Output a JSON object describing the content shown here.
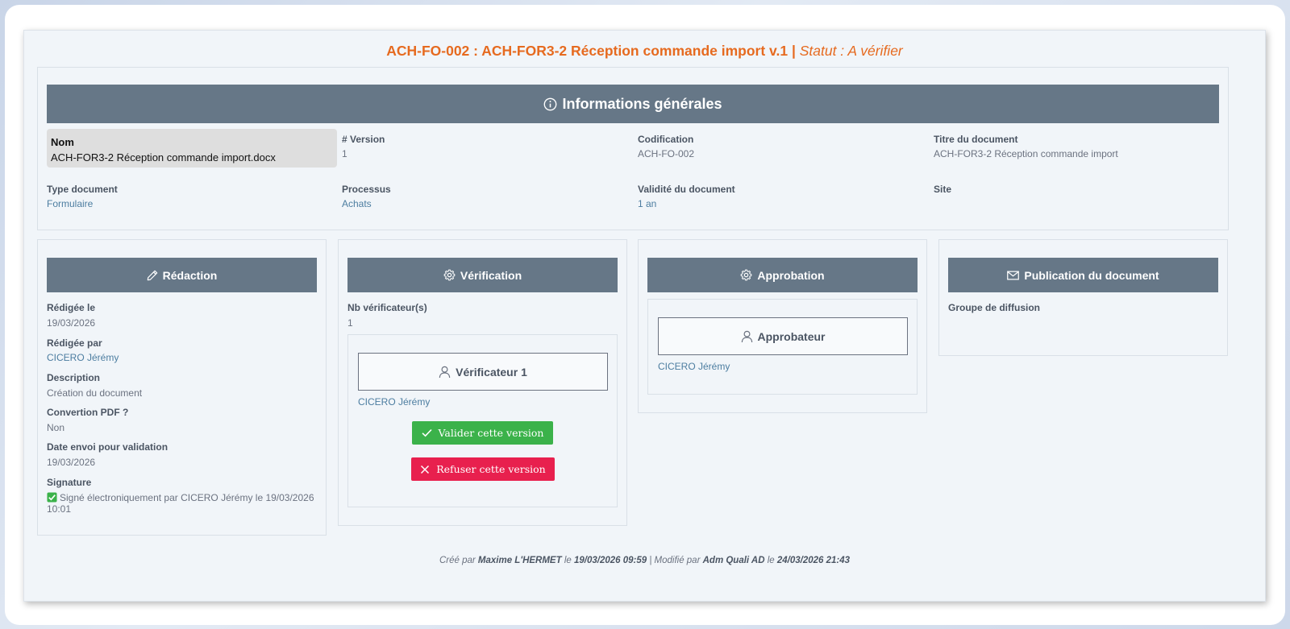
{
  "header": {
    "title_main": "ACH-FO-002 : ACH-FOR3-2 Réception commande import v.1",
    "title_sep": " | ",
    "title_status": "Statut : A vérifier"
  },
  "general": {
    "section_title": "Informations générales",
    "nom_label": "Nom",
    "nom_value": "ACH-FOR3-2 Réception commande import.docx",
    "version_label": "# Version",
    "version_value": "1",
    "codification_label": "Codification",
    "codification_value": "ACH-FO-002",
    "titre_label": "Titre du document",
    "titre_value": "ACH-FOR3-2 Réception commande import",
    "type_label": "Type document",
    "type_value": "Formulaire",
    "processus_label": "Processus",
    "processus_value": "Achats",
    "validite_label": "Validité du document",
    "validite_value": "1 an",
    "site_label": "Site"
  },
  "redaction": {
    "title": "Rédaction",
    "redigee_le_label": "Rédigée le",
    "redigee_le_value": "19/03/2026",
    "redigee_par_label": "Rédigée par",
    "redigee_par_value": "CICERO Jérémy",
    "description_label": "Description",
    "description_value": "Création du document",
    "pdf_label": "Convertion PDF ?",
    "pdf_value": "Non",
    "date_envoi_label": "Date envoi pour validation",
    "date_envoi_value": "19/03/2026",
    "signature_label": "Signature",
    "signature_value_line1": "Signé électroniquement par CICERO Jérémy le 19/03/2026",
    "signature_value_line2": "10:01"
  },
  "verification": {
    "title": "Vérification",
    "nb_label": "Nb vérificateur(s)",
    "nb_value": "1",
    "verificateur_label": "Vérificateur 1",
    "verificateur_name": "CICERO Jérémy",
    "validate_label": "Valider cette version",
    "refuse_label": "Refuser cette version"
  },
  "approbation": {
    "title": "Approbation",
    "approbateur_label": "Approbateur",
    "approbateur_name": "CICERO Jérémy"
  },
  "publication": {
    "title": "Publication du document",
    "groupe_label": "Groupe de diffusion"
  },
  "footer": {
    "cree_par_prefix": "Créé par ",
    "cree_par_name": "Maxime L'HERMET",
    "le1": " le ",
    "cree_date": "19/03/2026 09:59",
    "modifie_prefix": " | Modifié par ",
    "modifie_name": "Adm Quali AD",
    "le2": " le ",
    "modifie_date": "24/03/2026 21:43"
  },
  "colors": {
    "accent_orange": "#e66a1f",
    "header_slate": "#667787",
    "success": "#3bb24a",
    "danger": "#e8204e",
    "link_blue": "#4c7da0"
  },
  "icons": {
    "info": "info-circle-icon",
    "pencil": "pencil-icon",
    "gear": "gear-icon",
    "envelope": "envelope-icon",
    "user": "user-icon",
    "check": "check-icon",
    "close": "close-icon",
    "checkbox": "checked-checkbox-icon"
  }
}
